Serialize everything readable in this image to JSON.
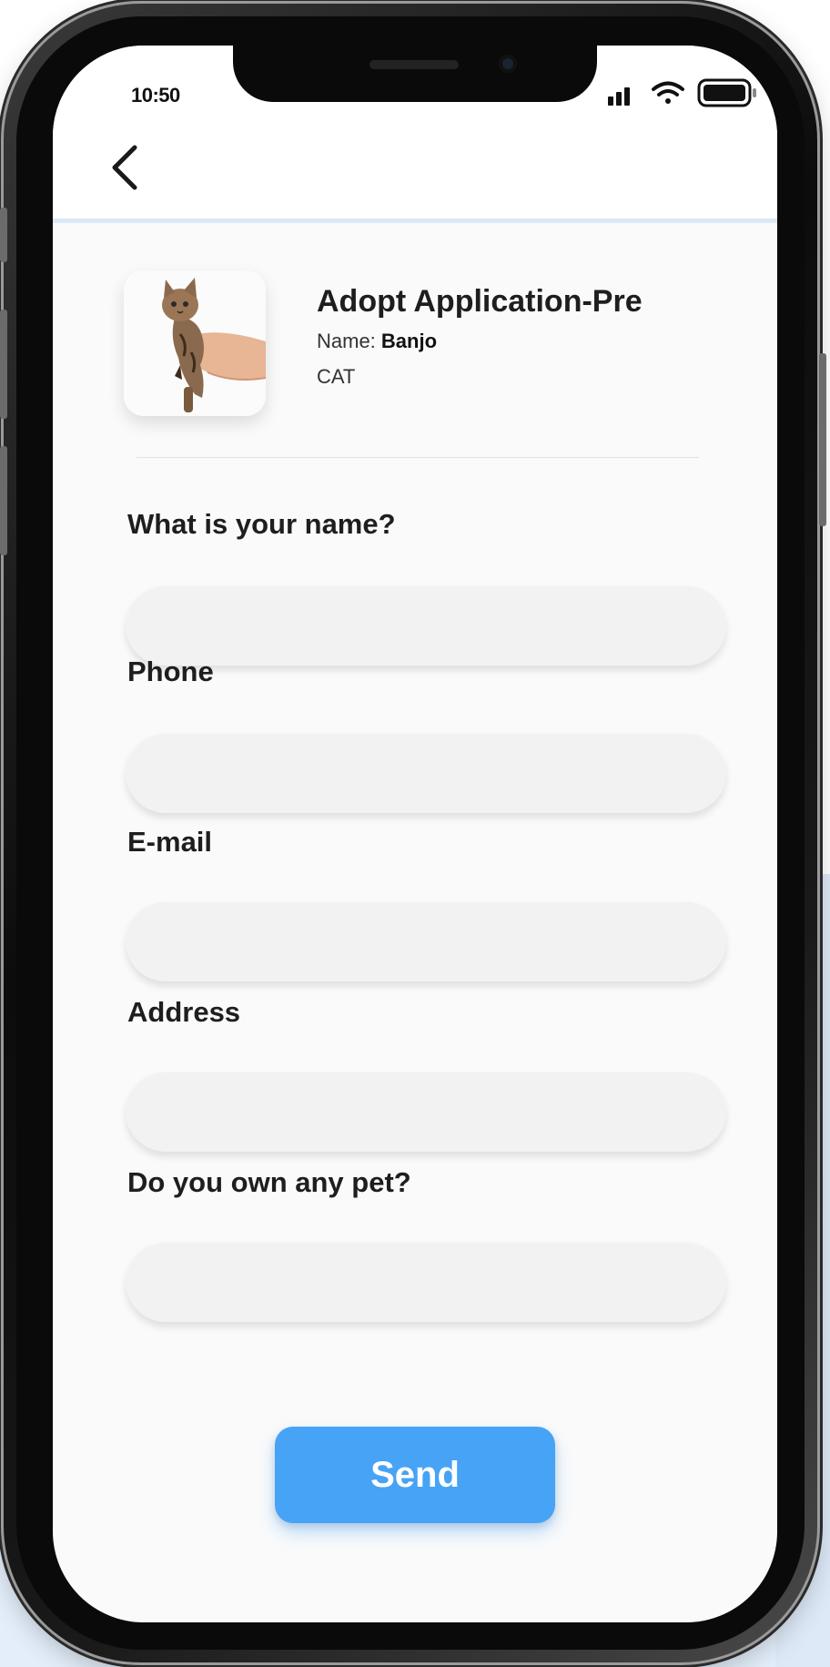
{
  "status_bar": {
    "time": "10:50"
  },
  "header": {
    "title": "Adopt Application-Pre",
    "name_label": "Name: ",
    "pet_name": "Banjo",
    "species": "CAT"
  },
  "form": {
    "fields": [
      {
        "label": "What is your name?",
        "value": "",
        "placeholder": ""
      },
      {
        "label": "Phone",
        "value": "",
        "placeholder": ""
      },
      {
        "label": "E-mail",
        "value": "",
        "placeholder": ""
      },
      {
        "label": "Address",
        "value": "",
        "placeholder": ""
      },
      {
        "label": "Do you own any pet?",
        "value": "",
        "placeholder": ""
      }
    ]
  },
  "actions": {
    "send_label": "Send"
  },
  "icons": {
    "back": "chevron-left-icon",
    "signal": "signal-icon",
    "wifi": "wifi-icon",
    "battery": "battery-icon"
  },
  "colors": {
    "primary": "#47a3f5",
    "input_bg": "#f2f2f2",
    "screen_bg": "#fafafa",
    "header_divider": "#dbe8f5"
  }
}
